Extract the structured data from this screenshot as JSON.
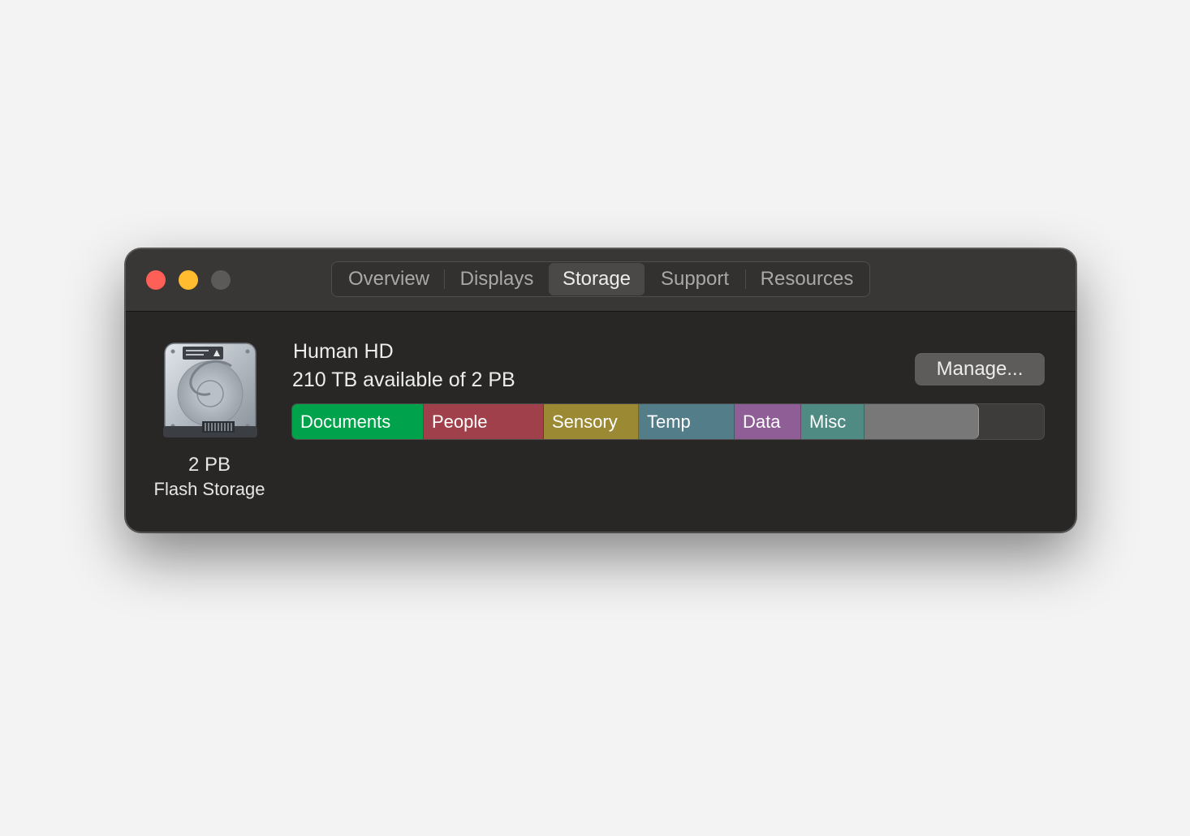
{
  "tabs": [
    {
      "label": "Overview",
      "active": false
    },
    {
      "label": "Displays",
      "active": false
    },
    {
      "label": "Storage",
      "active": true
    },
    {
      "label": "Support",
      "active": false
    },
    {
      "label": "Resources",
      "active": false
    }
  ],
  "disk": {
    "icon": "hard-drive-icon",
    "size": "2 PB",
    "type": "Flash Storage"
  },
  "volume": {
    "name": "Human HD",
    "availability": "210 TB available of 2 PB"
  },
  "manage_button": {
    "label": "Manage..."
  },
  "storage_bar": {
    "segments": [
      {
        "label": "Documents",
        "color": "#00a24b",
        "fraction": 0.175
      },
      {
        "label": "People",
        "color": "#a0404a",
        "fraction": 0.16
      },
      {
        "label": "Sensory",
        "color": "#9b8a33",
        "fraction": 0.126
      },
      {
        "label": "Temp",
        "color": "#527d89",
        "fraction": 0.127
      },
      {
        "label": "Data",
        "color": "#8f5e96",
        "fraction": 0.089
      },
      {
        "label": "Misc",
        "color": "#4f8a83",
        "fraction": 0.084
      },
      {
        "label": "",
        "color": "#787878",
        "fraction": 0.152
      }
    ]
  },
  "traffic_lights": {
    "close": "#fe5f57",
    "minimize": "#febc2e",
    "zoom": "#5b5a59"
  }
}
